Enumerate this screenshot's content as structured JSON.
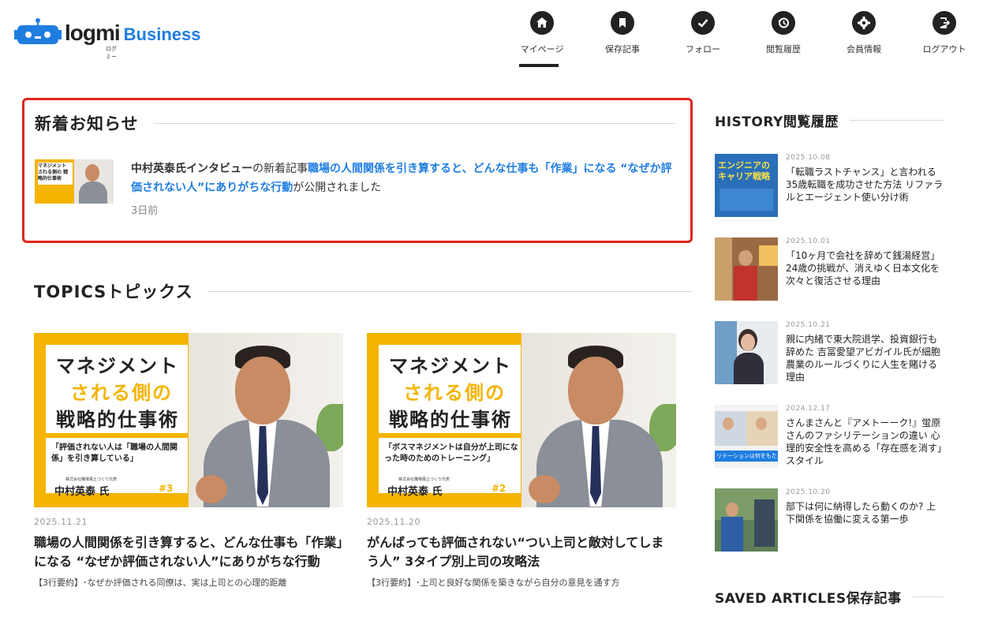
{
  "brand": {
    "logo_word": "logmi",
    "logo_ruby": "ログミー",
    "logo_sub": "Business"
  },
  "nav": [
    {
      "label": "マイページ",
      "icon": "home-icon"
    },
    {
      "label": "保存記事",
      "icon": "bookmark-icon"
    },
    {
      "label": "フォロー",
      "icon": "check-icon"
    },
    {
      "label": "閲覧履歴",
      "icon": "history-icon"
    },
    {
      "label": "会員情報",
      "icon": "gear-icon"
    },
    {
      "label": "ログアウト",
      "icon": "logout-icon"
    }
  ],
  "news": {
    "heading": "新着お知らせ",
    "item": {
      "name": "中村英泰氏インタビュー",
      "middle": "の新着記事",
      "link": "職場の人間関係を引き算すると、どんな仕事も「作業」になる “なぜか評価されない人”にありがちな行動",
      "suffix": "が公開されました",
      "time": "3日前",
      "thumb_text": "マネジメント される側の 戦略的仕事術"
    }
  },
  "topics": {
    "heading": "TOPICSトピックス",
    "cards": [
      {
        "img": {
          "t1": "マネジメント",
          "t2": "される側の",
          "t3": "戦略的仕事術",
          "quote": "「評価されない人は「職場の人間関係」を引き算している」",
          "org": "株式会社職場風土づくり代表",
          "person": "中村英泰 氏",
          "ep": "#3"
        },
        "date": "2025.11.21",
        "title": "職場の人間関係を引き算すると、どんな仕事も「作業」になる “なぜか評価されない人”にありがちな行動",
        "summary": "【3行要約】･なぜか評価される同僚は、実は上司との心理的距離"
      },
      {
        "img": {
          "t1": "マネジメント",
          "t2": "される側の",
          "t3": "戦略的仕事術",
          "quote": "「ボスマネジメントは自分が上司になった時のためのトレーニング」",
          "org": "株式会社職場風土づくり代表",
          "person": "中村英泰 氏",
          "ep": "#2"
        },
        "date": "2025.11.20",
        "title": "がんばっても評価されない“つい上司と敵対してしまう人” 3タイプ別上司の攻略法",
        "summary": "【3行要約】･上司と良好な関係を築きながら自分の意見を通す方"
      }
    ]
  },
  "history": {
    "heading": "HISTORY閲覧履歴",
    "items": [
      {
        "date": "2025.10.08",
        "title": "「転職ラストチャンス」と言われる35歳転職を成功させた方法 リファラルとエージェント使い分け術",
        "thumb_text": "エンジニアのキャリア戦略"
      },
      {
        "date": "2025.10.01",
        "title": "「10ヶ月で会社を辞めて銭湯経営」 24歳の挑戦が、消えゆく日本文化を次々と復活させる理由",
        "thumb_text": ""
      },
      {
        "date": "2025.10.21",
        "title": "親に内緒で東大院退学、投資銀行も辞めた 吉冨愛望アビガイル氏が細胞農業のルールづくりに人生を賭ける理由",
        "thumb_text": ""
      },
      {
        "date": "2024.12.17",
        "title": "さんまさんと『アメトーーク!』蛍原さんのファシリテーションの違い 心理的安全性を高める「存在感を消す」スタイル",
        "thumb_text": "リテーションは何をもたらす"
      },
      {
        "date": "2025.10.20",
        "title": "部下は何に納得したら動くのか? 上下関係を協働に変える第一歩",
        "thumb_text": ""
      }
    ]
  },
  "saved": {
    "heading": "SAVED ARTICLES保存記事"
  },
  "colors": {
    "accent": "#e0261c",
    "link": "#1f7de0",
    "brand_yellow": "#f4b400"
  }
}
